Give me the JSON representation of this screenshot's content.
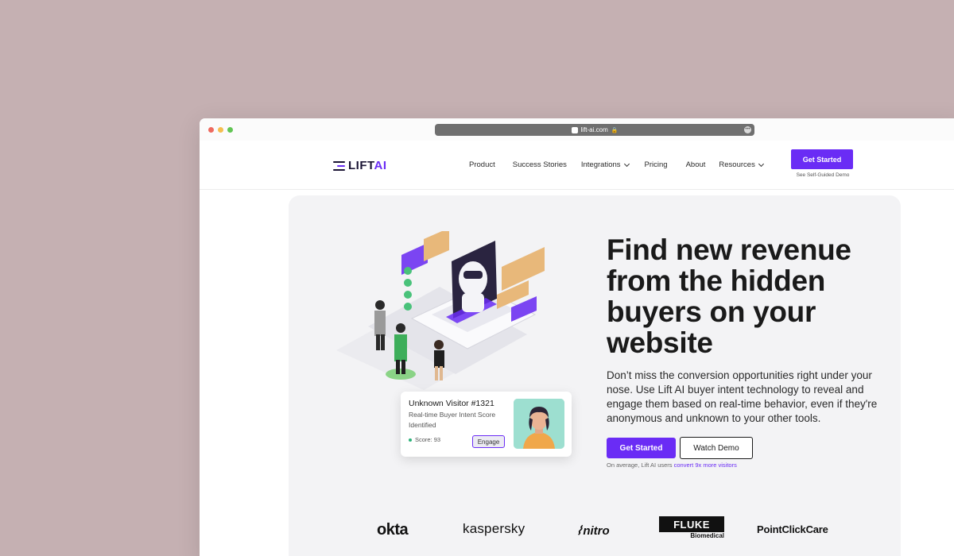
{
  "browser": {
    "url": "lift-ai.com"
  },
  "nav": {
    "logo_text": "LIFT",
    "logo_accent": "AI",
    "links": [
      {
        "label": "Product"
      },
      {
        "label": "Success Stories"
      },
      {
        "label": "Integrations",
        "dropdown": true
      },
      {
        "label": "Pricing"
      },
      {
        "label": "About"
      },
      {
        "label": "Resources",
        "dropdown": true
      }
    ],
    "cta_label": "Get Started",
    "demo_link": "See Self-Guided Demo"
  },
  "hero": {
    "headline": "Find new revenue from the hidden buyers on your website",
    "subtext": "Don’t miss the conversion opportunities right under your nose. Use Lift AI buyer intent technology to reveal and engage them based on real-time behavior, even if they're anonymous and unknown to your other tools.",
    "primary_button": "Get Started",
    "secondary_button": "Watch Demo",
    "footnote_prefix": "On average, Lift AI users",
    "footnote_link": "convert 9x more visitors"
  },
  "visitor_card": {
    "title": "Unknown Visitor #1321",
    "description": "Real-time Buyer Intent Score Identified",
    "score_label": "Score: 93",
    "engage_label": "Engage"
  },
  "logos": [
    {
      "name": "okta",
      "text": "okta"
    },
    {
      "name": "kaspersky",
      "text": "kaspersky"
    },
    {
      "name": "nitro",
      "text": "nitro"
    },
    {
      "name": "fluke",
      "text": "FLUKE",
      "sub": "Biomedical"
    },
    {
      "name": "pointclickcare",
      "text": "PointClickCare"
    }
  ],
  "colors": {
    "brand": "#6a2cf5",
    "page_bg": "#c5b0b2",
    "hero_bg": "#f3f3f5",
    "text_dark": "#1a1a1a"
  }
}
